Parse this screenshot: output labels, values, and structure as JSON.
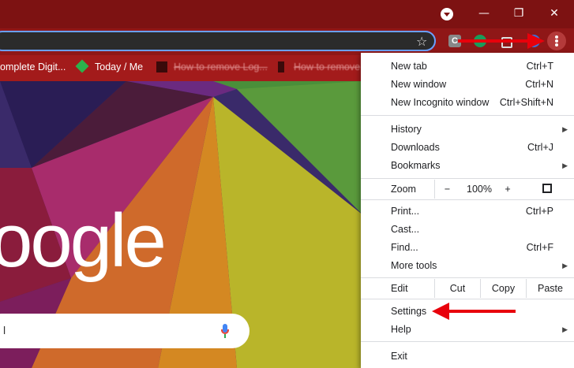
{
  "window": {
    "controls": {
      "minimize": "—",
      "restore": "❐",
      "close": "✕"
    }
  },
  "toolbar": {
    "star_icon": "star-icon",
    "menu_icon": "more-vert-icon"
  },
  "bookmarks": [
    {
      "label": "omplete Digit..."
    },
    {
      "label": "Today / Me"
    },
    {
      "label": "How to remove Log..."
    },
    {
      "label": "How to remove"
    }
  ],
  "page": {
    "logo_text": "oogle",
    "search_placeholder": "l"
  },
  "menu": {
    "new_tab": {
      "label": "New tab",
      "shortcut": "Ctrl+T"
    },
    "new_window": {
      "label": "New window",
      "shortcut": "Ctrl+N"
    },
    "new_incognito": {
      "label": "New Incognito window",
      "shortcut": "Ctrl+Shift+N"
    },
    "history": {
      "label": "History"
    },
    "downloads": {
      "label": "Downloads",
      "shortcut": "Ctrl+J"
    },
    "bookmarks": {
      "label": "Bookmarks"
    },
    "zoom": {
      "label": "Zoom",
      "minus": "−",
      "level": "100%",
      "plus": "+"
    },
    "print": {
      "label": "Print...",
      "shortcut": "Ctrl+P"
    },
    "cast": {
      "label": "Cast..."
    },
    "find": {
      "label": "Find...",
      "shortcut": "Ctrl+F"
    },
    "more_tools": {
      "label": "More tools"
    },
    "edit": {
      "label": "Edit",
      "cut": "Cut",
      "copy": "Copy",
      "paste": "Paste"
    },
    "settings": {
      "label": "Settings"
    },
    "help": {
      "label": "Help"
    },
    "exit": {
      "label": "Exit"
    }
  },
  "colors": {
    "titlebar": "#7d1212",
    "annotation_arrow": "#e8000b"
  }
}
